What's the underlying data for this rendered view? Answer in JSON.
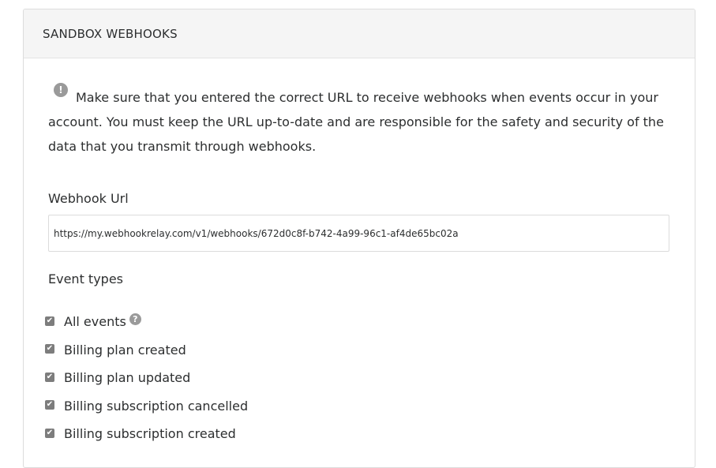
{
  "panel": {
    "title": "SANDBOX WEBHOOKS"
  },
  "notice": {
    "icon": "exclamation-circle-icon",
    "text": "Make sure that you entered the correct URL to receive webhooks when events occur in your account. You must keep the URL up-to-date and are responsible for the safety and security of the data that you transmit through webhooks."
  },
  "webhook": {
    "label": "Webhook Url",
    "value": "https://my.webhookrelay.com/v1/webhooks/672d0c8f-b742-4a99-96c1-af4de65bc02a"
  },
  "events": {
    "label": "Event types",
    "items": [
      {
        "label": "All events",
        "checked": true,
        "help_icon": "question-circle-icon"
      },
      {
        "label": "Billing plan created",
        "checked": true
      },
      {
        "label": "Billing plan updated",
        "checked": true
      },
      {
        "label": "Billing subscription cancelled",
        "checked": true
      },
      {
        "label": "Billing subscription created",
        "checked": true
      }
    ]
  },
  "colors": {
    "header_bg": "#f5f5f5",
    "border": "#dcdcdc",
    "text": "#2c2e2f",
    "checkbox": "#7d7d7d",
    "icon": "#9a9a9a"
  }
}
